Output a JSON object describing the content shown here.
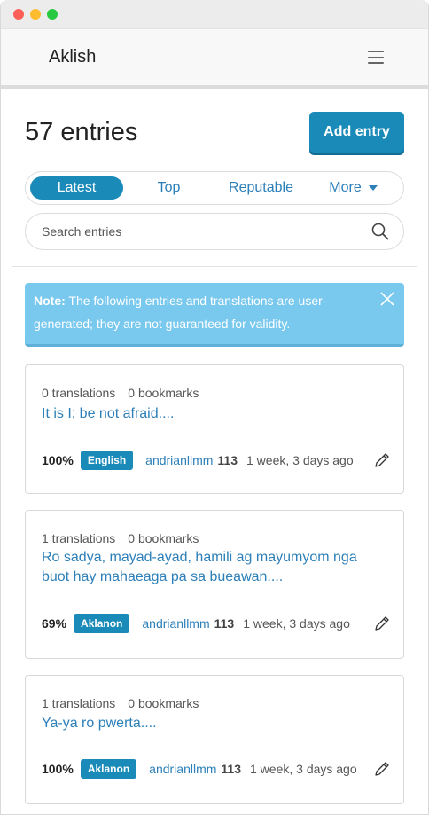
{
  "window": {
    "title": ""
  },
  "navbar": {
    "brand": "Aklish",
    "menu_icon": "hamburger-menu-icon"
  },
  "header": {
    "count": "57 entries",
    "add_label": "Add entry"
  },
  "tabs": [
    {
      "label": "Latest",
      "active": true
    },
    {
      "label": "Top",
      "active": false
    },
    {
      "label": "Reputable",
      "active": false
    },
    {
      "label": "More",
      "active": false
    }
  ],
  "search": {
    "placeholder": "Search entries",
    "icon": "search-icon"
  },
  "note": {
    "bold": "Note:",
    "text": " The following entries and translations are user-generated; they are not guaranteed for validity."
  },
  "entries": [
    {
      "translations": "0 translations",
      "bookmarks": "0 bookmarks",
      "title": "It is I; be not afraid....",
      "percent": "100%",
      "language": "English",
      "user": "andrianllmm",
      "reputation": "113",
      "time": "1 week, 3 days ago"
    },
    {
      "translations": "1 translations",
      "bookmarks": "0 bookmarks",
      "title": "Ro sadya, mayad-ayad, hamili ag mayumyom nga buot hay mahaeaga pa sa bueawan....",
      "percent": "69%",
      "language": "Aklanon",
      "user": "andrianllmm",
      "reputation": "113",
      "time": "1 week, 3 days ago"
    },
    {
      "translations": "1 translations",
      "bookmarks": "0 bookmarks",
      "title": "Ya-ya ro pwerta....",
      "percent": "100%",
      "language": "Aklanon",
      "user": "andrianllmm",
      "reputation": "113",
      "time": "1 week, 3 days ago"
    }
  ],
  "colors": {
    "primary": "#1a8ab8",
    "link": "#2c7fb8",
    "note_bg": "#79c8ee"
  }
}
